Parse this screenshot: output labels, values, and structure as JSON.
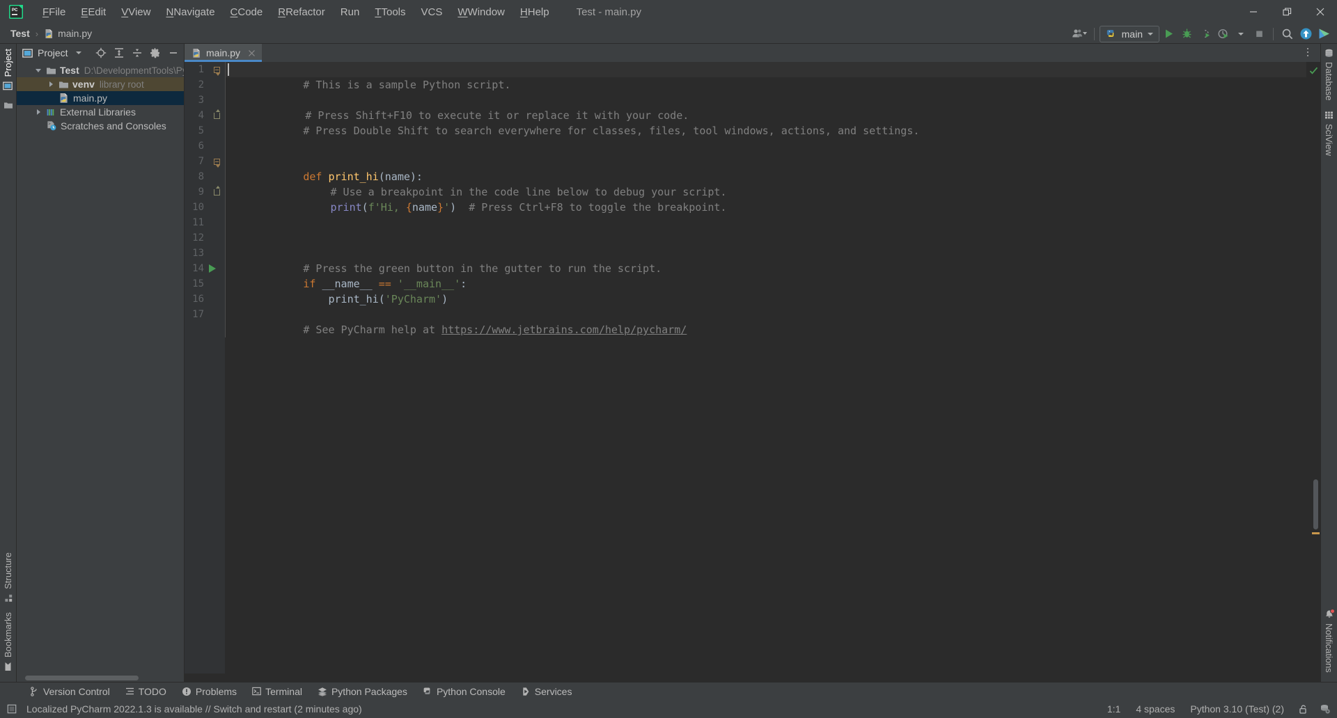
{
  "window": {
    "title": "Test - main.py",
    "controls": {
      "minimize": "minimize-button",
      "restore": "restore-button",
      "close": "close-button"
    }
  },
  "menubar": {
    "items": [
      {
        "label": "File",
        "mnemonic": "F"
      },
      {
        "label": "Edit",
        "mnemonic": "E"
      },
      {
        "label": "View",
        "mnemonic": "V"
      },
      {
        "label": "Navigate",
        "mnemonic": "N"
      },
      {
        "label": "Code",
        "mnemonic": "C"
      },
      {
        "label": "Refactor",
        "mnemonic": "R"
      },
      {
        "label": "Run",
        "mnemonic": "u"
      },
      {
        "label": "Tools",
        "mnemonic": "T"
      },
      {
        "label": "VCS",
        "mnemonic": "S"
      },
      {
        "label": "Window",
        "mnemonic": "W"
      },
      {
        "label": "Help",
        "mnemonic": "H"
      }
    ]
  },
  "navbar": {
    "breadcrumbs": [
      {
        "label": "Test",
        "icon": ""
      },
      {
        "label": "main.py",
        "icon": "python-file-icon"
      }
    ],
    "separator": "›"
  },
  "toolbar": {
    "account_icon": "user-account-icon",
    "run_config": {
      "label": "main",
      "icon": "python-config-icon"
    },
    "buttons": [
      {
        "name": "run-button",
        "icon": "play-icon",
        "color": "#499c54"
      },
      {
        "name": "debug-button",
        "icon": "bug-icon",
        "color": "#499c54"
      },
      {
        "name": "run-with-coverage-button",
        "icon": "coverage-icon",
        "color": "#499c54"
      },
      {
        "name": "profile-button",
        "icon": "profiler-icon",
        "color": "#499c54"
      },
      {
        "name": "stop-button",
        "icon": "stop-square-icon",
        "color": "#8a8a8a"
      },
      {
        "name": "search-everywhere-button",
        "icon": "search-icon",
        "color": "#b0b0b0"
      },
      {
        "name": "update-project-button",
        "icon": "arrow-up-circle-icon",
        "color": "#3592c4"
      },
      {
        "name": "code-with-me-button",
        "icon": "code-with-me-icon",
        "color": "#f4cf58"
      }
    ]
  },
  "left_stripe": {
    "top": [
      {
        "label": "Project",
        "icon": "project-panel-icon",
        "active": true
      }
    ],
    "top_icons": [
      {
        "label": "",
        "icon": "folder-icon"
      }
    ],
    "bottom": [
      {
        "label": "Structure",
        "icon": "structure-icon"
      },
      {
        "label": "Bookmarks",
        "icon": "bookmark-icon"
      }
    ]
  },
  "right_stripe": {
    "top": [
      {
        "label": "Database",
        "icon": "database-icon"
      },
      {
        "label": "SciView",
        "icon": "sciview-grid-icon"
      }
    ],
    "bottom": [
      {
        "label": "Notifications",
        "icon": "bell-icon",
        "badge": true
      }
    ]
  },
  "project_panel": {
    "title": "Project",
    "title_icon": "project-window-icon",
    "header_buttons": [
      {
        "name": "select-opened-file-button",
        "icon": "crosshair-target-icon"
      },
      {
        "name": "expand-all-button",
        "icon": "expand-all-icon"
      },
      {
        "name": "collapse-all-button",
        "icon": "collapse-all-icon"
      },
      {
        "name": "settings-button",
        "icon": "gear-icon"
      },
      {
        "name": "hide-button",
        "icon": "minus-icon"
      }
    ],
    "tree": [
      {
        "label": "Test",
        "sub": "D:\\DevelopmentTools\\PyCharm",
        "icon": "folder-icon",
        "expanded": true,
        "depth": 0,
        "bold": true,
        "state": "normal"
      },
      {
        "label": "venv",
        "sub": "library root",
        "icon": "folder-icon",
        "expanded": false,
        "depth": 1,
        "bold": true,
        "state": "venv"
      },
      {
        "label": "main.py",
        "sub": "",
        "icon": "python-file-icon",
        "depth": 2,
        "bold": false,
        "state": "selected"
      },
      {
        "label": "External Libraries",
        "sub": "",
        "icon": "libraries-icon",
        "expanded": false,
        "depth": 0,
        "bold": false,
        "state": "normal"
      },
      {
        "label": "Scratches and Consoles",
        "sub": "",
        "icon": "scratches-icon",
        "depth": 0,
        "bold": false,
        "state": "normal"
      }
    ]
  },
  "editor": {
    "tabs": [
      {
        "label": "main.py",
        "icon": "python-file-icon",
        "active": true,
        "close": "close-tab-icon"
      }
    ],
    "options_icon": "more-options-icon",
    "inspection_status": "ok-check-icon",
    "gutter": {
      "run_line": 13,
      "fold_lines": [
        1,
        4,
        7,
        9
      ]
    },
    "lines": [
      {
        "n": 1,
        "tokens": [
          {
            "t": "# This is a sample Python script.",
            "c": "t-cmt"
          }
        ]
      },
      {
        "n": 2,
        "tokens": []
      },
      {
        "n": 3,
        "tokens": [
          {
            "t": "# Press Shift+F10 to execute it or replace it with your code.",
            "c": "t-cmt"
          }
        ]
      },
      {
        "n": 4,
        "tokens": [
          {
            "t": "# Press Double Shift to search everywhere for classes, files, tool windows, actions, and settings.",
            "c": "t-cmt"
          }
        ]
      },
      {
        "n": 5,
        "tokens": []
      },
      {
        "n": 6,
        "tokens": []
      },
      {
        "n": 7,
        "tokens": [
          {
            "t": "def ",
            "c": "t-kw"
          },
          {
            "t": "print_hi",
            "c": "t-fn"
          },
          {
            "t": "(name):",
            "c": "t-plain"
          }
        ]
      },
      {
        "n": 8,
        "tokens": [
          {
            "t": "    # Use a breakpoint in the code line below to debug your script.",
            "c": "t-cmt"
          }
        ]
      },
      {
        "n": 9,
        "tokens": [
          {
            "t": "    ",
            "c": "t-plain"
          },
          {
            "t": "print",
            "c": "t-bi"
          },
          {
            "t": "(",
            "c": "t-plain"
          },
          {
            "t": "f'Hi, ",
            "c": "t-str"
          },
          {
            "t": "{",
            "c": "t-brace"
          },
          {
            "t": "name",
            "c": "t-plain"
          },
          {
            "t": "}",
            "c": "t-brace"
          },
          {
            "t": "'",
            "c": "t-str"
          },
          {
            "t": ")  ",
            "c": "t-plain"
          },
          {
            "t": "# Press Ctrl+F8 to toggle the breakpoint.",
            "c": "t-cmt"
          }
        ]
      },
      {
        "n": 10,
        "tokens": []
      },
      {
        "n": 11,
        "tokens": []
      },
      {
        "n": 12,
        "tokens": [
          {
            "t": "# Press the green button in the gutter to run the script.",
            "c": "t-cmt"
          }
        ]
      },
      {
        "n": 13,
        "tokens": [
          {
            "t": "if ",
            "c": "t-kw"
          },
          {
            "t": "__name__ ",
            "c": "t-plain"
          },
          {
            "t": "== ",
            "c": "t-kw"
          },
          {
            "t": "'__main__'",
            "c": "t-str"
          },
          {
            "t": ":",
            "c": "t-plain"
          }
        ]
      },
      {
        "n": 14,
        "tokens": [
          {
            "t": "    print_hi(",
            "c": "t-plain"
          },
          {
            "t": "'PyCharm'",
            "c": "t-str"
          },
          {
            "t": ")",
            "c": "t-plain"
          }
        ]
      },
      {
        "n": 15,
        "tokens": []
      },
      {
        "n": 16,
        "tokens": [
          {
            "t": "# See PyCharm help at ",
            "c": "t-cmt"
          },
          {
            "t": "https://www.jetbrains.com/help/pycharm/",
            "c": "t-link"
          }
        ]
      },
      {
        "n": 17,
        "tokens": []
      }
    ]
  },
  "tool_window_bar": {
    "items": [
      {
        "label": "Version Control",
        "icon": "branch-icon"
      },
      {
        "label": "TODO",
        "icon": "list-icon"
      },
      {
        "label": "Problems",
        "icon": "error-circle-icon"
      },
      {
        "label": "Terminal",
        "icon": "terminal-icon"
      },
      {
        "label": "Python Packages",
        "icon": "packages-icon"
      },
      {
        "label": "Python Console",
        "icon": "python-console-icon"
      },
      {
        "label": "Services",
        "icon": "services-play-icon"
      }
    ]
  },
  "statusbar": {
    "notification_icon": "ide-update-icon",
    "message": "Localized PyCharm 2022.1.3 is available // Switch and restart (2 minutes ago)",
    "caret_position": "1:1",
    "indent": "4 spaces",
    "interpreter": "Python 3.10 (Test) (2)",
    "lock_icon": "unlocked-padlock-icon",
    "db_icon": "database-settings-icon"
  },
  "colors": {
    "chrome": "#3c3f41",
    "editor_bg": "#2b2b2b",
    "gutter_bg": "#313335",
    "accent_blue": "#4a88c7",
    "selection": "#0d293e",
    "venv_highlight": "#4e4733",
    "green_run": "#499c54",
    "comment": "#808080",
    "keyword": "#cc7832",
    "string": "#6a8759",
    "function": "#ffc66d",
    "builtin": "#8888c6",
    "default_text": "#a9b7c6"
  }
}
